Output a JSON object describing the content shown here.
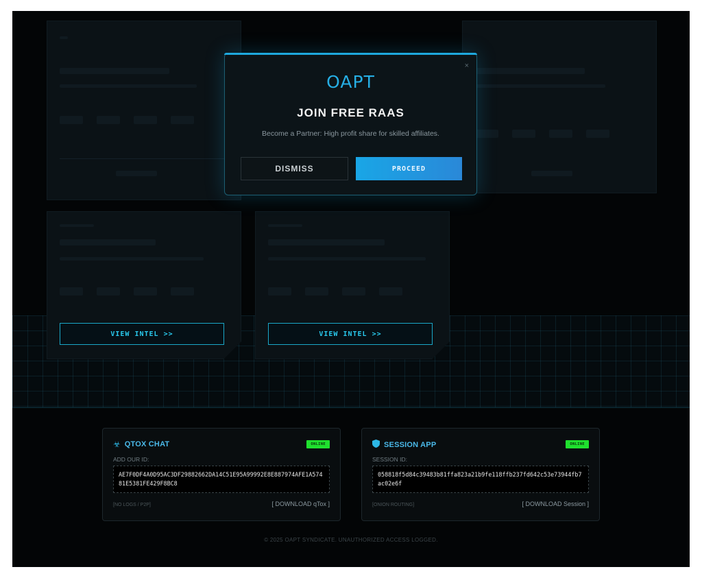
{
  "modal": {
    "close": "×",
    "logo": "OAPT",
    "title": "JOIN FREE RAAS",
    "subtitle": "Become a Partner: High profit share for skilled affiliates.",
    "dismiss_label": "DISMISS",
    "proceed_label": "PROCEED"
  },
  "cards": {
    "view_intel_label": "VIEW INTEL >>"
  },
  "qtox": {
    "icon": "biohazard-icon",
    "title": "QTOX CHAT",
    "status": "ONLINE",
    "label": "ADD OUR ID:",
    "id_value": "AE7F0DF4A0D95AC3DF29882662DA14C51E95A99992E8E887974AFE1A57481E5381FE429F8BC8",
    "note": "[NO LOGS / P2P]",
    "download_label": "[ DOWNLOAD qTox ]"
  },
  "session": {
    "icon": "shield-icon",
    "title": "SESSION APP",
    "status": "ONLINE",
    "label": "SESSION ID:",
    "id_value": "058818f5d84c39483b81ffa823a21b9fe118ffb237fd642c53e73944fb7ac02e6f",
    "note": "[ONION ROUTING]",
    "download_label": "[ DOWNLOAD Session ]"
  },
  "footer": "© 2025 OAPT SYNDICATE. UNAUTHORIZED ACCESS LOGGED."
}
